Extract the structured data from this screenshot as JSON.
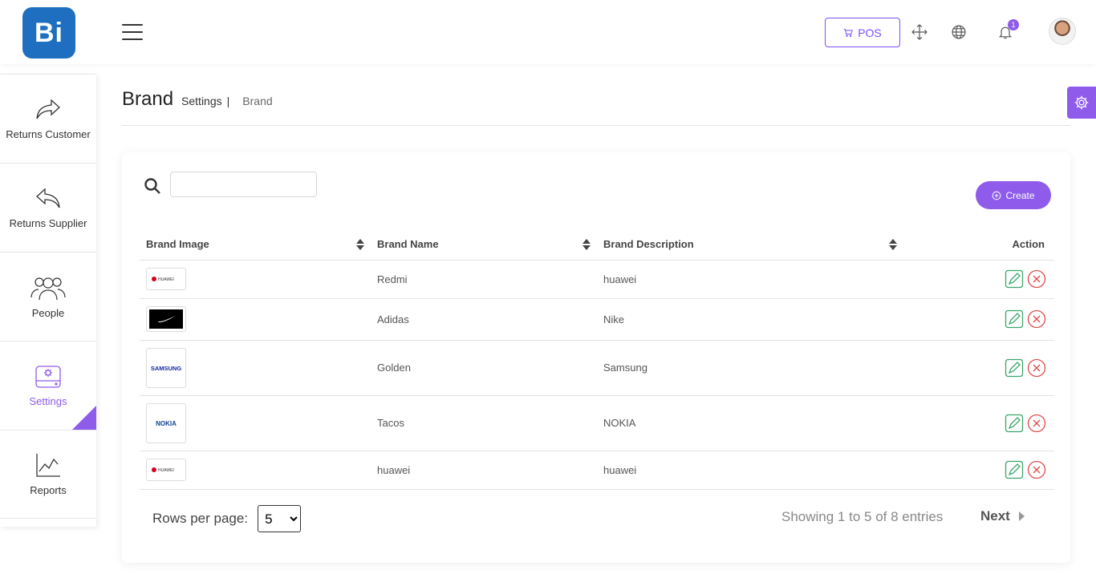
{
  "app": {
    "logo_text": "Bi"
  },
  "header": {
    "pos_label": "POS",
    "notification_count": "1"
  },
  "sidebar": {
    "items": [
      {
        "label": "Returns Customer",
        "icon": "share-arrow-icon"
      },
      {
        "label": "Returns Supplier",
        "icon": "reply-arrow-icon"
      },
      {
        "label": "People",
        "icon": "people-icon"
      },
      {
        "label": "Settings",
        "icon": "settings-drive-icon",
        "active": true
      },
      {
        "label": "Reports",
        "icon": "line-chart-icon"
      }
    ]
  },
  "page": {
    "title": "Brand",
    "breadcrumb_parent": "Settings",
    "breadcrumb_separator": "|",
    "breadcrumb_current": "Brand"
  },
  "toolbar": {
    "search_value": "",
    "create_label": "Create"
  },
  "table": {
    "columns": [
      "Brand Image",
      "Brand Name",
      "Brand Description",
      "Action"
    ],
    "rows": [
      {
        "image_text": "HUAWEI",
        "name": "Redmi",
        "description": "huawei"
      },
      {
        "image_text": "nike-swoosh",
        "name": "Adidas",
        "description": "Nike"
      },
      {
        "image_text": "SAMSUNG",
        "name": "Golden",
        "description": "Samsung"
      },
      {
        "image_text": "NOKIA",
        "name": "Tacos",
        "description": "NOKIA"
      },
      {
        "image_text": "HUAWEI",
        "name": "huawei",
        "description": "huawei"
      }
    ]
  },
  "pagination": {
    "rows_per_page_label": "Rows per page:",
    "rows_per_page_value": "5",
    "showing_text": "Showing 1 to 5 of 8 entries",
    "next_label": "Next"
  },
  "colors": {
    "accent": "#8e5bea",
    "logo": "#1e6fbf",
    "edit": "#3aa56a",
    "delete": "#e04848"
  }
}
